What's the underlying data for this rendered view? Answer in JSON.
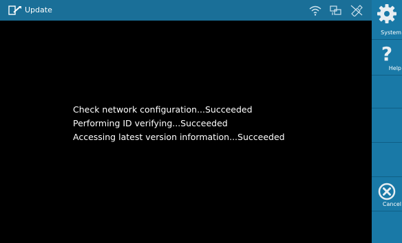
{
  "title_bar": {
    "title": "Update",
    "icon": "update-icon",
    "status_icons": [
      "wifi-icon",
      "network-connection-icon",
      "usb-icon"
    ]
  },
  "messages": [
    "Check network configuration...Succeeded",
    "Performing ID verifying...Succeeded",
    "Accessing latest version information...Succeeded"
  ],
  "sidebar": {
    "buttons": [
      {
        "label": "System",
        "icon": "gear-icon"
      },
      {
        "label": "Help",
        "icon": "help-icon"
      },
      {
        "label": "",
        "icon": ""
      },
      {
        "label": "",
        "icon": ""
      },
      {
        "label": "",
        "icon": ""
      },
      {
        "label": "Cancel",
        "icon": "cancel-icon"
      },
      {
        "label": "",
        "icon": ""
      }
    ]
  },
  "colors": {
    "title_bar": "#1a6f98",
    "sidebar": "#1979a7",
    "content_background": "#000000",
    "text": "#ffffff"
  }
}
